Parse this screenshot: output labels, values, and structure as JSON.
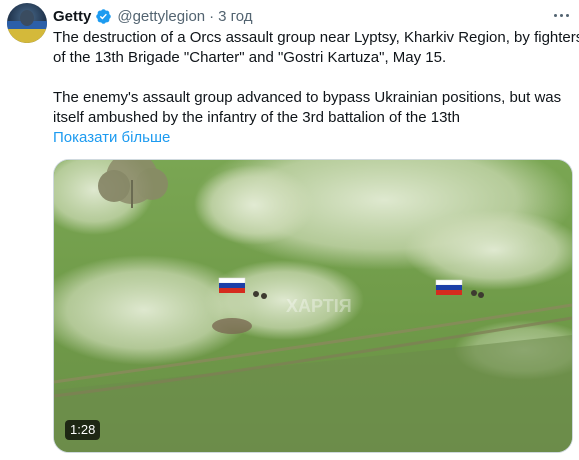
{
  "tweet": {
    "author_name": "Getty",
    "handle": "@gettylegion",
    "separator": "·",
    "time": "3 год",
    "line1": "The destruction of a Orcs assault group near Lyptsy, Kharkiv Region, by fighters",
    "line2": "of the 13th Brigade \"Charter\" and \"Gostri Kartuza\", May 15.",
    "line3": "The enemy's assault group advanced to bypass Ukrainian positions, but was",
    "line4": "itself ambushed by the infantry of the 3rd battalion of the 13th",
    "show_more": "Показати більше"
  },
  "media": {
    "duration": "1:28",
    "watermark": "ХАРТІЯ",
    "flag_colors": [
      "#ffffff",
      "#1c3fa8",
      "#d52b1e"
    ]
  },
  "icons": {
    "avatar": "avatar",
    "verified": "verified-badge-icon",
    "more": "more-options-icon"
  },
  "colors": {
    "link": "#1d9bf0",
    "verified": "#1d9bf0",
    "secondary_text": "#536471"
  }
}
